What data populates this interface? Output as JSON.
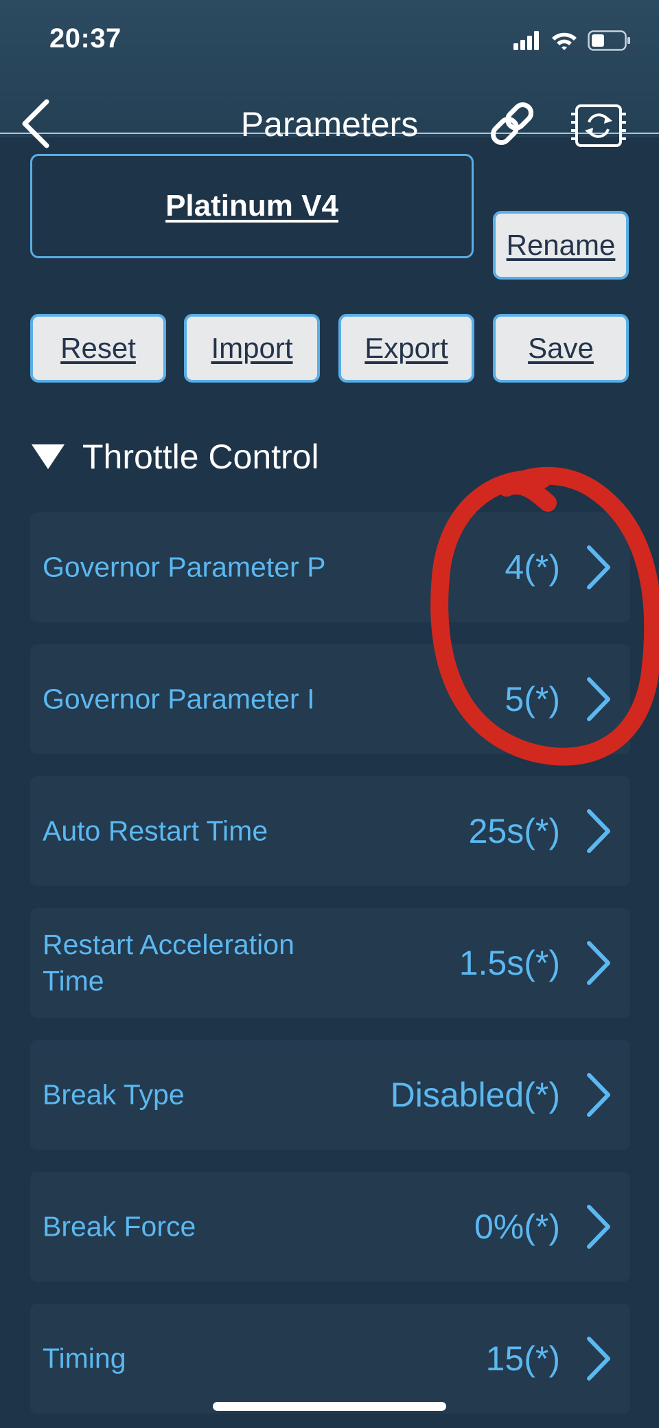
{
  "status_bar": {
    "time": "20:37",
    "icons": [
      "cellular-signal-icon",
      "wifi-icon",
      "battery-icon"
    ]
  },
  "nav": {
    "title": "Parameters",
    "back_icon": "chevron-left-icon",
    "link_icon": "link-icon",
    "sync_icon": "chip-sync-icon"
  },
  "profile": {
    "name": "Platinum V4",
    "rename_label": "Rename"
  },
  "actions": {
    "reset_label": "Reset",
    "import_label": "Import",
    "export_label": "Export",
    "save_label": "Save"
  },
  "section": {
    "title": "Throttle Control",
    "expanded": true
  },
  "rows": [
    {
      "label": "Governor Parameter P",
      "value": "4(*)"
    },
    {
      "label": "Governor Parameter I",
      "value": "5(*)"
    },
    {
      "label": "Auto Restart Time",
      "value": "25s(*)"
    },
    {
      "label": "Restart Acceleration Time",
      "value": "1.5s(*)"
    },
    {
      "label": "Break Type",
      "value": "Disabled(*)"
    },
    {
      "label": "Break Force",
      "value": "0%(*)"
    },
    {
      "label": "Timing",
      "value": "15(*)"
    }
  ],
  "colors": {
    "background": "#1e3448",
    "accent": "#5cb8f0",
    "row_background": "#233a4f",
    "annotation": "#e0281c",
    "button_fill": "#e8e9eb"
  }
}
